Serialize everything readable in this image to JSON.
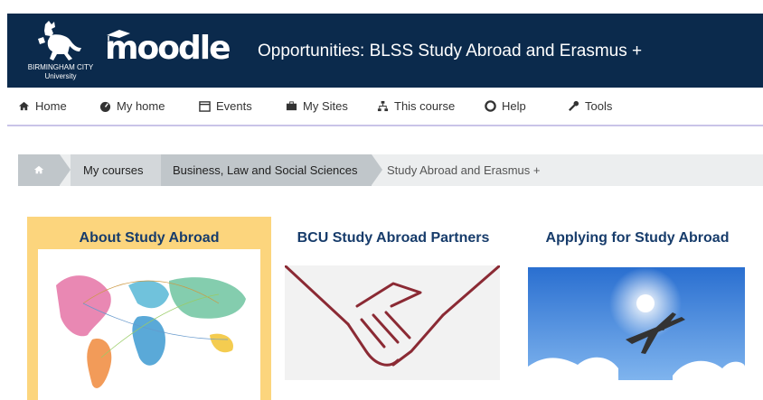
{
  "header": {
    "university_name": "BIRMINGHAM CITY",
    "university_sub": "University",
    "brand": "moodle",
    "course_title": "Opportunities: BLSS Study Abroad and Erasmus +"
  },
  "nav": {
    "items": [
      {
        "label": "Home",
        "icon": "home-icon"
      },
      {
        "label": "My home",
        "icon": "dashboard-icon"
      },
      {
        "label": "Events",
        "icon": "calendar-icon"
      },
      {
        "label": "My Sites",
        "icon": "briefcase-icon"
      },
      {
        "label": "This course",
        "icon": "sitemap-icon"
      },
      {
        "label": "Help",
        "icon": "lifebuoy-icon"
      },
      {
        "label": "Tools",
        "icon": "wrench-icon"
      }
    ]
  },
  "breadcrumb": {
    "items": [
      "My courses",
      "Business, Law and Social Sciences"
    ],
    "current": "Study Abroad and Erasmus +"
  },
  "tiles": [
    {
      "title": "About Study Abroad",
      "image": "world-map-image"
    },
    {
      "title": "BCU Study Abroad Partners",
      "image": "handshake-image"
    },
    {
      "title": "Applying for Study Abroad",
      "image": "airplane-image"
    }
  ],
  "colors": {
    "header_bg": "#0b2a4c",
    "tile_title": "#173c6b",
    "highlight_tile": "#fcd57d",
    "handshake": "#8b2a34"
  }
}
